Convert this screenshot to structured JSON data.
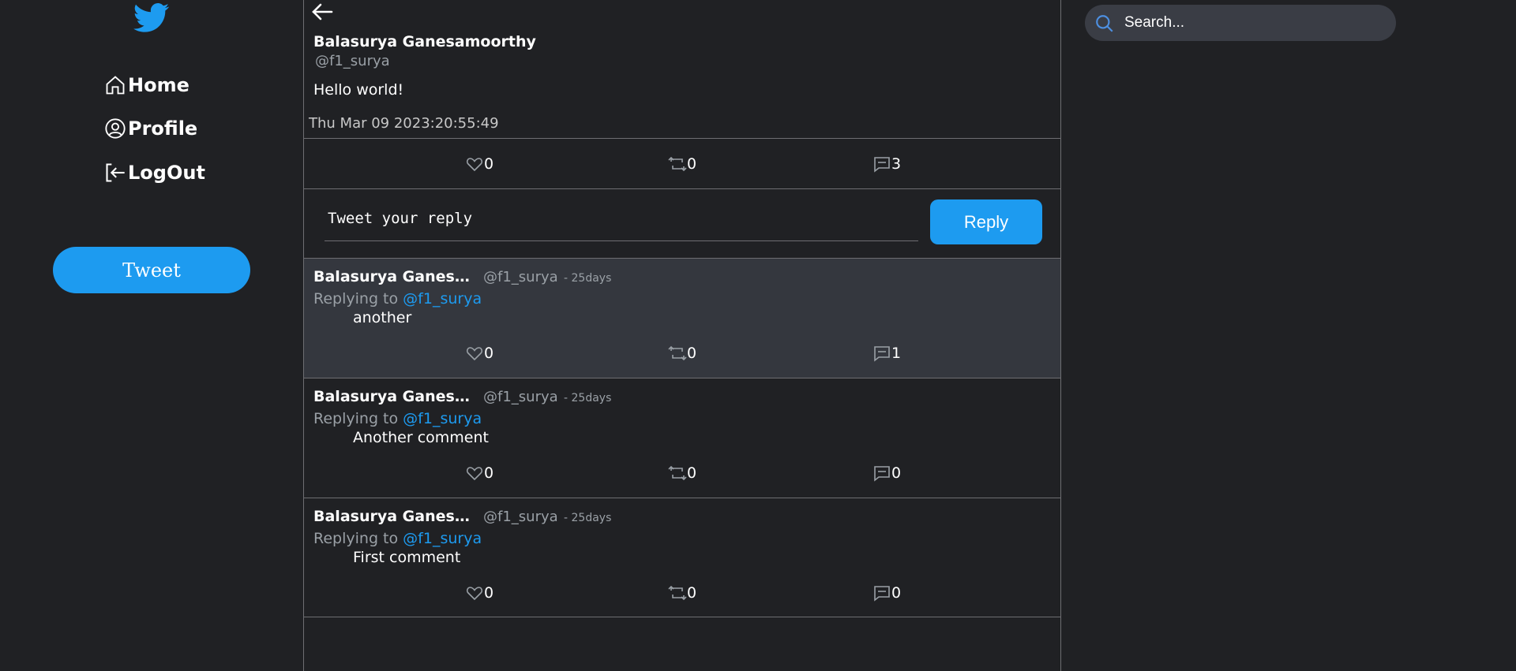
{
  "sidebar": {
    "nav": {
      "home": "Home",
      "profile": "Profile",
      "logout": "LogOut"
    },
    "tweet_button": "Tweet"
  },
  "tweet": {
    "author_name": "Balasurya Ganesamoorthy",
    "author_handle": "@f1_surya",
    "text": "Hello world!",
    "date": "Thu Mar 09 2023:20:55:49",
    "likes": "0",
    "retweets": "0",
    "replies": "3"
  },
  "reply": {
    "placeholder": "Tweet your reply",
    "button": "Reply"
  },
  "comments": [
    {
      "name": "Balasurya Ganesamoorthy",
      "handle": "@f1_surya",
      "time": "- 25days",
      "replying_prefix": "Replying to",
      "replying_to": "@f1_surya",
      "text": "another",
      "likes": "0",
      "retweets": "0",
      "replies": "1"
    },
    {
      "name": "Balasurya Ganesamoorthy",
      "handle": "@f1_surya",
      "time": "- 25days",
      "replying_prefix": "Replying to",
      "replying_to": "@f1_surya",
      "text": "Another comment",
      "likes": "0",
      "retweets": "0",
      "replies": "0"
    },
    {
      "name": "Balasurya Ganesamoorthy",
      "handle": "@f1_surya",
      "time": "- 25days",
      "replying_prefix": "Replying to",
      "replying_to": "@f1_surya",
      "text": "First comment",
      "likes": "0",
      "retweets": "0",
      "replies": "0"
    }
  ],
  "search": {
    "placeholder": "Search..."
  },
  "colors": {
    "accent": "#1d9bf0",
    "background": "#202124",
    "highlight": "#34373e"
  }
}
